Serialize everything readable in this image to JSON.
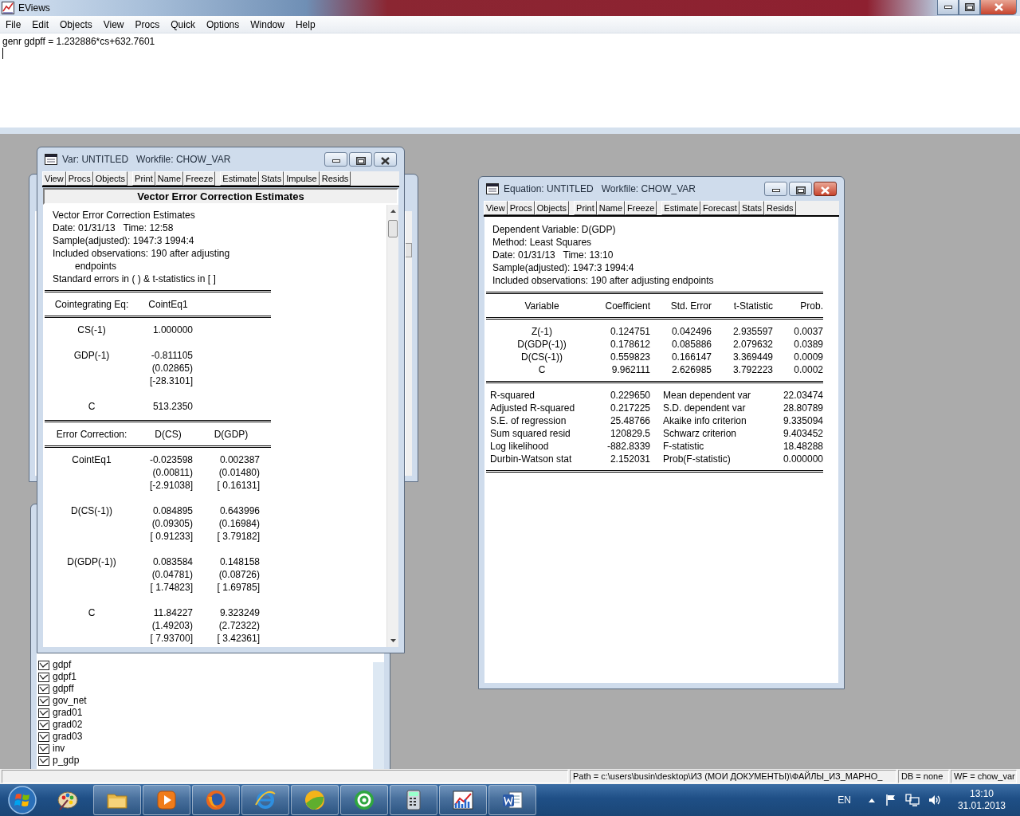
{
  "app": {
    "title": "EViews"
  },
  "menu": [
    "File",
    "Edit",
    "Objects",
    "View",
    "Procs",
    "Quick",
    "Options",
    "Window",
    "Help"
  ],
  "command": {
    "value": "genr gdpff = 1.232886*cs+632.7601"
  },
  "workfile": {
    "items": [
      "gdpf",
      "gdpf1",
      "gdpff",
      "gov_net",
      "grad01",
      "grad02",
      "grad03",
      "inv",
      "p_gdp"
    ]
  },
  "var_window": {
    "title": "Var: UNTITLED   Workfile: CHOW_VAR",
    "active": false,
    "toolbar": [
      [
        "View",
        "Procs",
        "Objects"
      ],
      [
        "Print",
        "Name",
        "Freeze"
      ],
      [
        "Estimate",
        "Stats",
        "Impulse",
        "Resids"
      ]
    ],
    "heading": "Vector Error Correction Estimates",
    "header_lines": [
      {
        "text": "Vector Error Correction Estimates",
        "kind": "line"
      },
      {
        "text": "Date: 01/31/13   Time: 12:58",
        "kind": "line"
      },
      {
        "text": "Sample(adjusted): 1947:3 1994:4",
        "kind": "line"
      },
      {
        "text": "Included observations: 190 after adjusting",
        "kind": "line"
      },
      {
        "text": "endpoints",
        "kind": "continuation"
      },
      {
        "text": "Standard errors in ( ) & t-statistics in [ ]",
        "kind": "line"
      }
    ],
    "tables": [
      {
        "columns": [
          "Cointegrating Eq:",
          "CointEq1"
        ],
        "rows": [
          {
            "label": "CS(-1)",
            "values": [
              [
                "1.000000"
              ]
            ]
          },
          {
            "label": "GDP(-1)",
            "values": [
              [
                "-0.811105",
                "(0.02865)",
                "[-28.3101]"
              ]
            ]
          },
          {
            "label": "C",
            "values": [
              [
                "513.2350"
              ]
            ]
          }
        ]
      },
      {
        "columns": [
          "Error Correction:",
          "D(CS)",
          "D(GDP)"
        ],
        "rows": [
          {
            "label": "CointEq1",
            "values": [
              [
                "-0.023598",
                "(0.00811)",
                "[-2.91038]"
              ],
              [
                "0.002387",
                "(0.01480)",
                "[ 0.16131]"
              ]
            ]
          },
          {
            "label": "D(CS(-1))",
            "values": [
              [
                "0.084895",
                "(0.09305)",
                "[ 0.91233]"
              ],
              [
                "0.643996",
                "(0.16984)",
                "[ 3.79182]"
              ]
            ]
          },
          {
            "label": "D(GDP(-1))",
            "values": [
              [
                "0.083584",
                "(0.04781)",
                "[ 1.74823]"
              ],
              [
                "0.148158",
                "(0.08726)",
                "[ 1.69785]"
              ]
            ]
          },
          {
            "label": "C",
            "values": [
              [
                "11.84227",
                "(1.49203)",
                "[ 7.93700]"
              ],
              [
                "9.323249",
                "(2.72322)",
                "[ 3.42361]"
              ]
            ]
          }
        ]
      }
    ]
  },
  "equation_window": {
    "title": "Equation: UNTITLED   Workfile: CHOW_VAR",
    "active": true,
    "toolbar": [
      [
        "View",
        "Procs",
        "Objects"
      ],
      [
        "Print",
        "Name",
        "Freeze"
      ],
      [
        "Estimate",
        "Forecast",
        "Stats",
        "Resids"
      ]
    ],
    "header_lines": [
      "Dependent Variable: D(GDP)",
      "Method: Least Squares",
      "Date: 01/31/13   Time: 13:10",
      "Sample(adjusted): 1947:3 1994:4",
      "Included observations: 190 after adjusting endpoints"
    ],
    "columns": [
      "Variable",
      "Coefficient",
      "Std. Error",
      "t-Statistic",
      "Prob."
    ],
    "rows": [
      [
        "Z(-1)",
        "0.124751",
        "0.042496",
        "2.935597",
        "0.0037"
      ],
      [
        "D(GDP(-1))",
        "0.178612",
        "0.085886",
        "2.079632",
        "0.0389"
      ],
      [
        "D(CS(-1))",
        "0.559823",
        "0.166147",
        "3.369449",
        "0.0009"
      ],
      [
        "C",
        "9.962111",
        "2.626985",
        "3.792223",
        "0.0002"
      ]
    ],
    "stats": [
      [
        "R-squared",
        "0.229650",
        "Mean dependent var",
        "22.03474"
      ],
      [
        "Adjusted R-squared",
        "0.217225",
        "S.D. dependent var",
        "28.80789"
      ],
      [
        "S.E. of regression",
        "25.48766",
        "Akaike info criterion",
        "9.335094"
      ],
      [
        "Sum squared resid",
        "120829.5",
        "Schwarz criterion",
        "9.403452"
      ],
      [
        "Log likelihood",
        "-882.8339",
        "F-statistic",
        "18.48288"
      ],
      [
        "Durbin-Watson stat",
        "2.152031",
        "Prob(F-statistic)",
        "0.000000"
      ]
    ]
  },
  "status_bar": {
    "path": "Path = c:\\users\\busin\\desktop\\ИЗ (МОИ ДОКУМЕНТЫ)\\ФАЙЛЫ_ИЗ_МАРНО_",
    "db": "DB = none",
    "wf": "WF = chow_var"
  },
  "taskbar": {
    "apps": [
      {
        "kind": "paint",
        "running": false
      },
      {
        "kind": "folder",
        "running": true
      },
      {
        "kind": "media",
        "running": true
      },
      {
        "kind": "firefox",
        "running": true
      },
      {
        "kind": "ie",
        "running": true
      },
      {
        "kind": "disc",
        "running": true
      },
      {
        "kind": "mail",
        "running": true
      },
      {
        "kind": "calc",
        "running": true
      },
      {
        "kind": "eviews",
        "running": true
      },
      {
        "kind": "word",
        "running": true
      }
    ],
    "language": "EN",
    "time": "13:10",
    "date": "31.01.2013"
  }
}
